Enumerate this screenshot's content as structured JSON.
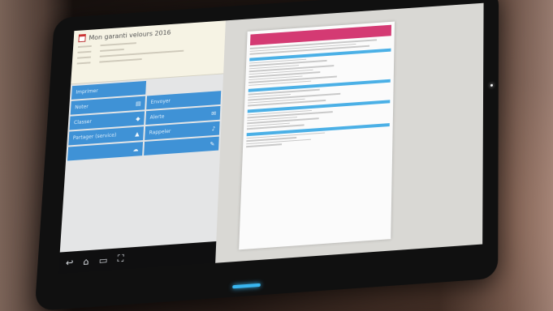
{
  "info_card": {
    "title": "Mon garanti velours 2016",
    "rows": [
      {
        "key": "",
        "value": ""
      },
      {
        "key": "",
        "value": ""
      },
      {
        "key": "",
        "value": ""
      },
      {
        "key": "",
        "value": ""
      }
    ]
  },
  "buttons": [
    {
      "label": "Imprimer",
      "icon": "",
      "color": "#3f92d6"
    },
    {
      "label": "",
      "icon": "",
      "color": "#e4e5e6"
    },
    {
      "label": "Noter",
      "icon": "printer-icon",
      "color": "#3f92d6"
    },
    {
      "label": "Envoyer",
      "icon": "",
      "color": "#3f92d6"
    },
    {
      "label": "Classer",
      "icon": "tag-icon",
      "color": "#3f92d6"
    },
    {
      "label": "Alerte",
      "icon": "mail-icon",
      "color": "#3f92d6"
    },
    {
      "label": "Partager (service)",
      "icon": "stamp-icon",
      "color": "#3f92d6"
    },
    {
      "label": "Rappeler",
      "icon": "bell-icon",
      "color": "#3f92d6"
    },
    {
      "label": "",
      "icon": "cloud-icon",
      "color": "#3f92d6"
    },
    {
      "label": "",
      "icon": "pen-icon",
      "color": "#3f92d6"
    }
  ],
  "nav_icons": [
    "back-icon",
    "home-icon",
    "recent-apps-icon",
    "screenshot-icon"
  ],
  "document": {
    "header_color": "#d43a73",
    "section_color": "#4bb0e6"
  },
  "colors": {
    "tile_blue": "#3f92d6",
    "info_card_bg": "#f6f3e4",
    "earpiece_glow": "#39b6f0"
  }
}
